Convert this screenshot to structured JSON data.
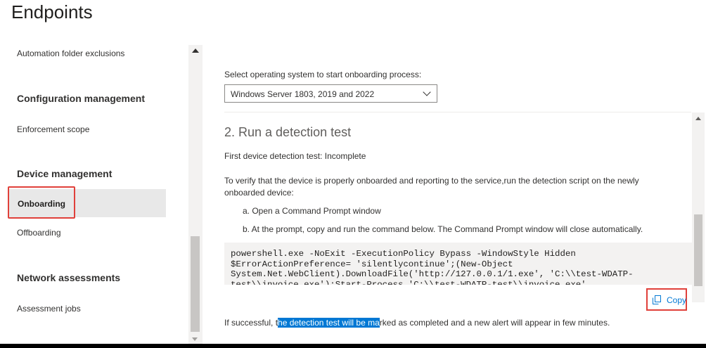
{
  "page": {
    "title": "Endpoints"
  },
  "sidebar": {
    "items": [
      {
        "label": "Automation folder exclusions"
      },
      {
        "heading": "Configuration management"
      },
      {
        "label": "Enforcement scope"
      },
      {
        "heading": "Device management"
      },
      {
        "label": "Onboarding",
        "selected": true
      },
      {
        "label": "Offboarding"
      },
      {
        "heading": "Network assessments"
      },
      {
        "label": "Assessment jobs"
      }
    ]
  },
  "main": {
    "os_label": "Select operating system to start onboarding process:",
    "os_select": {
      "value": "Windows Server 1803, 2019 and 2022"
    },
    "step_title": "2. Run a detection test",
    "detection_status": "First device detection test: Incomplete",
    "verify_text": "To verify that the device is properly onboarded and reporting to the service,run the detection script on the newly onboarded device:",
    "step_a": "a. Open a Command Prompt window",
    "step_b": "b. At the prompt, copy and run the command below. The Command Prompt window will close automatically.",
    "code": "powershell.exe -NoExit -ExecutionPolicy Bypass -WindowStyle Hidden\n$ErrorActionPreference= 'silentlycontinue';(New-Object\nSystem.Net.WebClient).DownloadFile('http://127.0.0.1/1.exe', 'C:\\\\test-WDATP-\ntest\\\\invoice.exe');Start-Process 'C:\\\\test-WDATP-test\\\\invoice.exe'",
    "copy_label": "Copy",
    "result": {
      "before": "If successful, t",
      "highlighted": "he detection test will be ma",
      "after": "rked as completed and a new alert will appear in few minutes."
    }
  },
  "colors": {
    "accent": "#0078d4",
    "annotation": "#e0403a",
    "selected_bg": "#e8e8e8"
  },
  "icons": {
    "copy": "copy-icon",
    "dropdown": "chevron-down-icon"
  }
}
